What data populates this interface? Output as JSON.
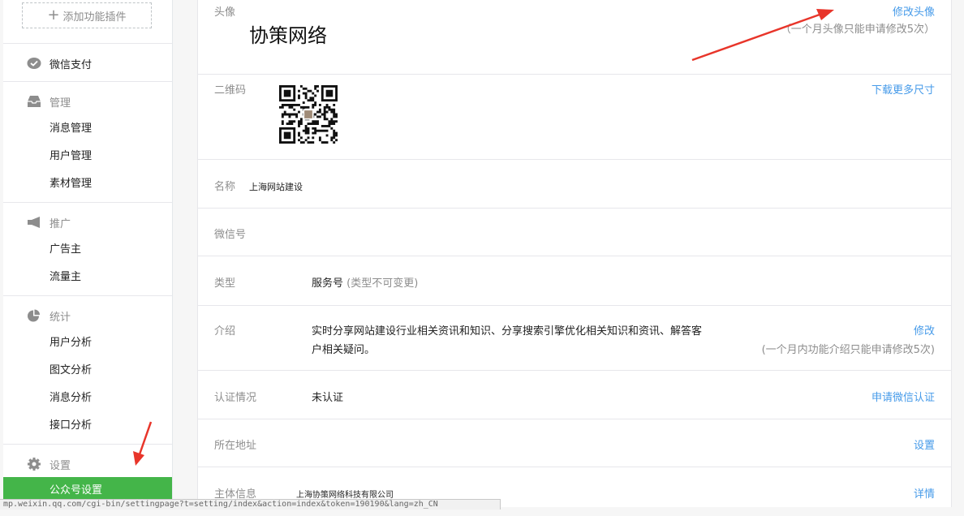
{
  "sidebar": {
    "add_plugin": "添加功能插件",
    "wechat_pay": "微信支付",
    "sections": [
      {
        "title": "管理",
        "items": [
          "消息管理",
          "用户管理",
          "素材管理"
        ]
      },
      {
        "title": "推广",
        "items": [
          "广告主",
          "流量主"
        ]
      },
      {
        "title": "统计",
        "items": [
          "用户分析",
          "图文分析",
          "消息分析",
          "接口分析"
        ]
      },
      {
        "title": "设置",
        "items": [
          "公众号设置"
        ]
      }
    ]
  },
  "account": {
    "avatar": {
      "label": "头像",
      "name": "协策网络",
      "action": "修改头像",
      "tip": "（一个月头像只能申请修改5次）"
    },
    "qrcode": {
      "label": "二维码",
      "action": "下载更多尺寸"
    },
    "name": {
      "label": "名称",
      "value": "上海网站建设"
    },
    "wechat_id": {
      "label": "微信号"
    },
    "type": {
      "label": "类型",
      "value": "服务号",
      "note": "(类型不可变更)"
    },
    "intro": {
      "label": "介绍",
      "line1": "实时分享网站建设行业相关资讯和知识、分享搜索引擎优化相关知识和资讯、解答客",
      "line2": "户相关疑问。",
      "action": "修改",
      "tip": "(一个月内功能介绍只能申请修改5次)"
    },
    "verify": {
      "label": "认证情况",
      "value": "未认证",
      "action": "申请微信认证"
    },
    "address": {
      "label": "所在地址",
      "action": "设置"
    },
    "entity": {
      "label": "主体信息",
      "value": "上海协策网络科技有限公司",
      "action": "详情"
    }
  },
  "statusbar": {
    "url": "mp.weixin.qq.com/cgi-bin/settingpage?t=setting/index&action=index&token=190190&lang=zh_CN"
  },
  "colors": {
    "green": "#44b549",
    "link": "#459ae9",
    "arrow": "#e8352a"
  }
}
